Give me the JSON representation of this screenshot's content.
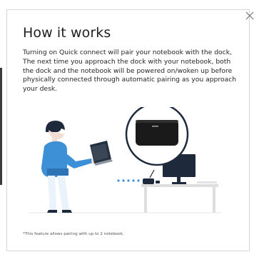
{
  "dialog": {
    "title": "How it works",
    "description": "Turning on Quick connect will pair your notebook with the dock, The next time you approach the dock with your notebook, both the dock and the notebook will be powered on/woken up before physically connected through automatic pairing as you approach your desk.",
    "footnote": "*This feature allows pairing with up to 2 notebook.",
    "close_icon": "close-icon",
    "illustration_icon": "person-notebook-dock-illustration"
  },
  "colors": {
    "title": "#1f1f1f",
    "text": "#262626",
    "accent_blue": "#3d8fd6",
    "dark": "#1e2a3c"
  }
}
